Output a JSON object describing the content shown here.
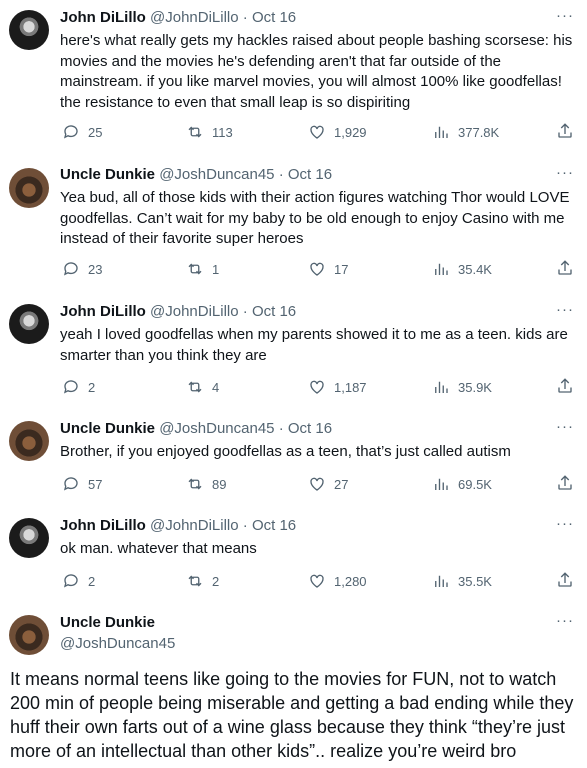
{
  "tweets": [
    {
      "name": "John DiLillo",
      "handle": "@JohnDiLillo",
      "dot": "·",
      "date": "Oct 16",
      "text": "here's what really gets my hackles raised about people bashing scorsese: his movies and the movies he's defending aren't that far outside of the mainstream. if you like marvel movies, you will almost 100% like goodfellas! the resistance to even that small leap is so dispiriting",
      "replies": "25",
      "retweets": "113",
      "likes": "1,929",
      "views": "377.8K"
    },
    {
      "name": "Uncle Dunkie",
      "handle": "@JoshDuncan45",
      "dot": "·",
      "date": "Oct 16",
      "text": "Yea bud, all of those kids with their action figures watching Thor would LOVE goodfellas. Can’t wait for my baby to be old enough to enjoy Casino with me instead of their favorite super heroes",
      "replies": "23",
      "retweets": "1",
      "likes": "17",
      "views": "35.4K"
    },
    {
      "name": "John DiLillo",
      "handle": "@JohnDiLillo",
      "dot": "·",
      "date": "Oct 16",
      "text": "yeah I loved goodfellas when my parents showed it to me as a teen. kids are smarter than you think they are",
      "replies": "2",
      "retweets": "4",
      "likes": "1,187",
      "views": "35.9K"
    },
    {
      "name": "Uncle Dunkie",
      "handle": "@JoshDuncan45",
      "dot": "·",
      "date": "Oct 16",
      "text": "Brother, if you enjoyed goodfellas as a teen, that’s just called autism",
      "replies": "57",
      "retweets": "89",
      "likes": "27",
      "views": "69.5K"
    },
    {
      "name": "John DiLillo",
      "handle": "@JohnDiLillo",
      "dot": "·",
      "date": "Oct 16",
      "text": "ok man. whatever that means",
      "replies": "2",
      "retweets": "2",
      "likes": "1,280",
      "views": "35.5K"
    }
  ],
  "focused": {
    "name": "Uncle Dunkie",
    "handle": "@JoshDuncan45",
    "text": "It means normal teens like going to the movies for FUN, not to watch 200 min of people being miserable and getting a bad ending while they huff their own farts out of a wine glass because they think “they’re just more of an intellectual than other kids”.. realize you’re weird bro"
  },
  "more_label": "···",
  "icons": {
    "reply": "reply-icon",
    "retweet": "retweet-icon",
    "like": "like-icon",
    "views": "views-icon",
    "share": "share-icon"
  },
  "colors": {
    "text": "#0f1419",
    "muted": "#536471",
    "background": "#ffffff"
  }
}
